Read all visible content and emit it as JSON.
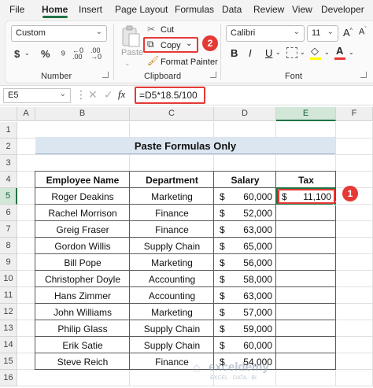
{
  "menu": {
    "tabs": [
      "File",
      "Home",
      "Insert",
      "Page Layout",
      "Formulas",
      "Data",
      "Review",
      "View",
      "Developer"
    ],
    "active": "Home"
  },
  "ribbon": {
    "number_format": "Custom",
    "currency_symbol": "$",
    "percent_symbol": "%",
    "paste_label": "Paste",
    "cut_label": "Cut",
    "copy_label": "Copy",
    "format_painter_label": "Format Painter",
    "font_name": "Calibri",
    "font_size": "11",
    "bold_label": "B",
    "italic_label": "I",
    "underline_label": "U",
    "group_number": "Number",
    "group_clipboard": "Clipboard",
    "group_font": "Font",
    "callout_copy": "2"
  },
  "formula_bar": {
    "name_box": "E5",
    "fx_label": "fx",
    "formula": "=D5*18.5/100"
  },
  "sheet": {
    "columns": [
      "A",
      "B",
      "C",
      "D",
      "E",
      "F"
    ],
    "rows": [
      "1",
      "2",
      "3",
      "4",
      "5",
      "6",
      "7",
      "8",
      "9",
      "10",
      "11",
      "12",
      "13",
      "14",
      "15",
      "16"
    ],
    "title": "Paste Formulas Only",
    "headers": [
      "Employee Name",
      "Department",
      "Salary",
      "Tax"
    ],
    "currency": "$",
    "data": [
      {
        "name": "Roger Deakins",
        "dept": "Marketing",
        "salary": "60,000",
        "tax": "11,100"
      },
      {
        "name": "Rachel Morrison",
        "dept": "Finance",
        "salary": "52,000",
        "tax": ""
      },
      {
        "name": "Greig Fraser",
        "dept": "Finance",
        "salary": "63,000",
        "tax": ""
      },
      {
        "name": "Gordon Willis",
        "dept": "Supply Chain",
        "salary": "65,000",
        "tax": ""
      },
      {
        "name": "Bill Pope",
        "dept": "Marketing",
        "salary": "56,000",
        "tax": ""
      },
      {
        "name": "Christopher Doyle",
        "dept": "Accounting",
        "salary": "58,000",
        "tax": ""
      },
      {
        "name": "Hans Zimmer",
        "dept": "Accounting",
        "salary": "63,000",
        "tax": ""
      },
      {
        "name": "John Williams",
        "dept": "Marketing",
        "salary": "57,000",
        "tax": ""
      },
      {
        "name": "Philip Glass",
        "dept": "Supply Chain",
        "salary": "59,000",
        "tax": ""
      },
      {
        "name": "Erik Satie",
        "dept": "Supply Chain",
        "salary": "60,000",
        "tax": ""
      },
      {
        "name": "Steve Reich",
        "dept": "Finance",
        "salary": "54,000",
        "tax": ""
      }
    ],
    "callout_tax": "1",
    "watermark": "exceldemy",
    "watermark_sub": "EXCEL · DATA · BI"
  },
  "colors": {
    "accent": "#217346",
    "title_fill": "#dce6f1",
    "callout": "#e53935"
  }
}
